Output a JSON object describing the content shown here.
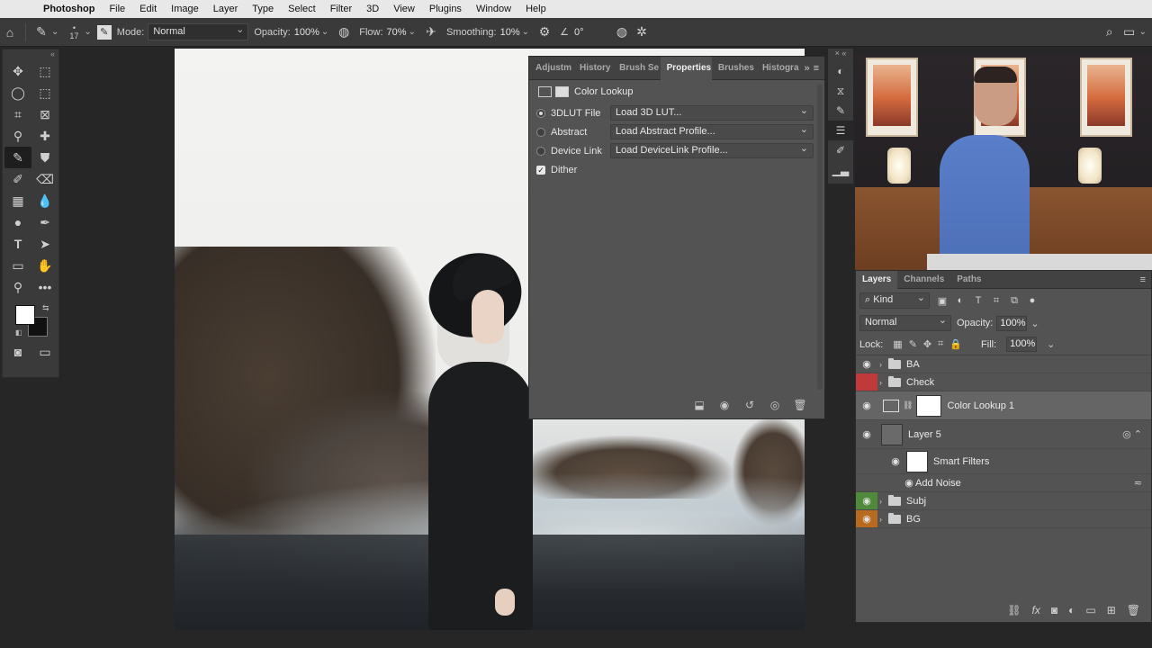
{
  "menubar": {
    "apple_icon": "apple-icon",
    "app_name": "Photoshop",
    "items": [
      "File",
      "Edit",
      "Image",
      "Layer",
      "Type",
      "Select",
      "Filter",
      "3D",
      "View",
      "Plugins",
      "Window",
      "Help"
    ]
  },
  "options_bar": {
    "brush_size": "17",
    "mode_label": "Mode:",
    "mode_value": "Normal",
    "opacity_label": "Opacity:",
    "opacity_value": "100%",
    "flow_label": "Flow:",
    "flow_value": "70%",
    "smoothing_label": "Smoothing:",
    "smoothing_value": "10%",
    "angle_value": "0°"
  },
  "properties_panel": {
    "tabs": [
      "Adjustm",
      "History",
      "Brush Se",
      "Properties",
      "Brushes",
      "Histogra"
    ],
    "active_tab": "Properties",
    "title": "Color Lookup",
    "rows": [
      {
        "label": "3DLUT File",
        "value": "Load 3D LUT...",
        "selected": true
      },
      {
        "label": "Abstract",
        "value": "Load Abstract Profile...",
        "selected": false
      },
      {
        "label": "Device Link",
        "value": "Load DeviceLink Profile...",
        "selected": false
      }
    ],
    "dither_label": "Dither",
    "dither_checked": true
  },
  "layers_panel": {
    "tabs": [
      "Layers",
      "Channels",
      "Paths"
    ],
    "active_tab": "Layers",
    "filter_kind": "Kind",
    "blend_mode": "Normal",
    "opacity_label": "Opacity:",
    "opacity_value": "100%",
    "lock_label": "Lock:",
    "fill_label": "Fill:",
    "fill_value": "100%",
    "layers": [
      {
        "name": "BA",
        "type": "group",
        "visible": true,
        "color": ""
      },
      {
        "name": "Check",
        "type": "group",
        "visible": false,
        "color": "#c0393b"
      },
      {
        "name": "Color Lookup 1",
        "type": "adjustment",
        "visible": true,
        "selected": true,
        "color": ""
      },
      {
        "name": "Layer 5",
        "type": "smart-object",
        "visible": true,
        "color": ""
      },
      {
        "name": "Smart Filters",
        "type": "smart-filters",
        "visible": true,
        "color": ""
      },
      {
        "name": "Add Noise",
        "type": "filter",
        "visible": true,
        "color": ""
      },
      {
        "name": "Subj",
        "type": "group",
        "visible": true,
        "color": "#4f8a3a"
      },
      {
        "name": "BG",
        "type": "group",
        "visible": true,
        "color": "#b86a1f"
      }
    ]
  },
  "colors": {
    "foreground": "#ffffff",
    "background": "#111111",
    "ui_dark": "#3a3a3a",
    "panel": "#535353"
  }
}
